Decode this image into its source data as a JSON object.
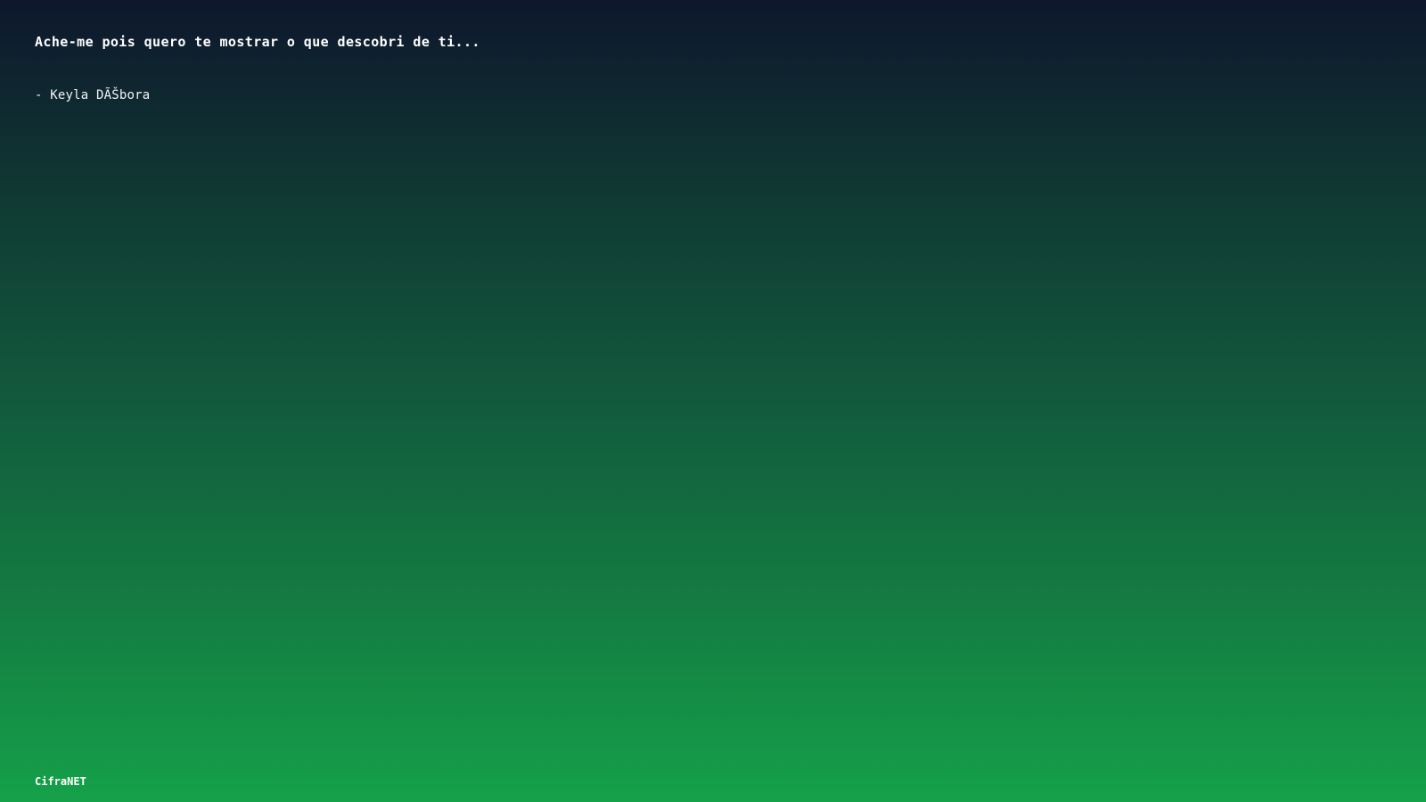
{
  "screen": {
    "quote": "Ache-me pois quero te mostrar o que descobri de ti...",
    "author": "- Keyla DÃŠbora",
    "brand": "CifraNET"
  },
  "colors": {
    "gradient_top": "#0e172d",
    "gradient_bottom": "#15a149",
    "text": "#ffffff"
  }
}
